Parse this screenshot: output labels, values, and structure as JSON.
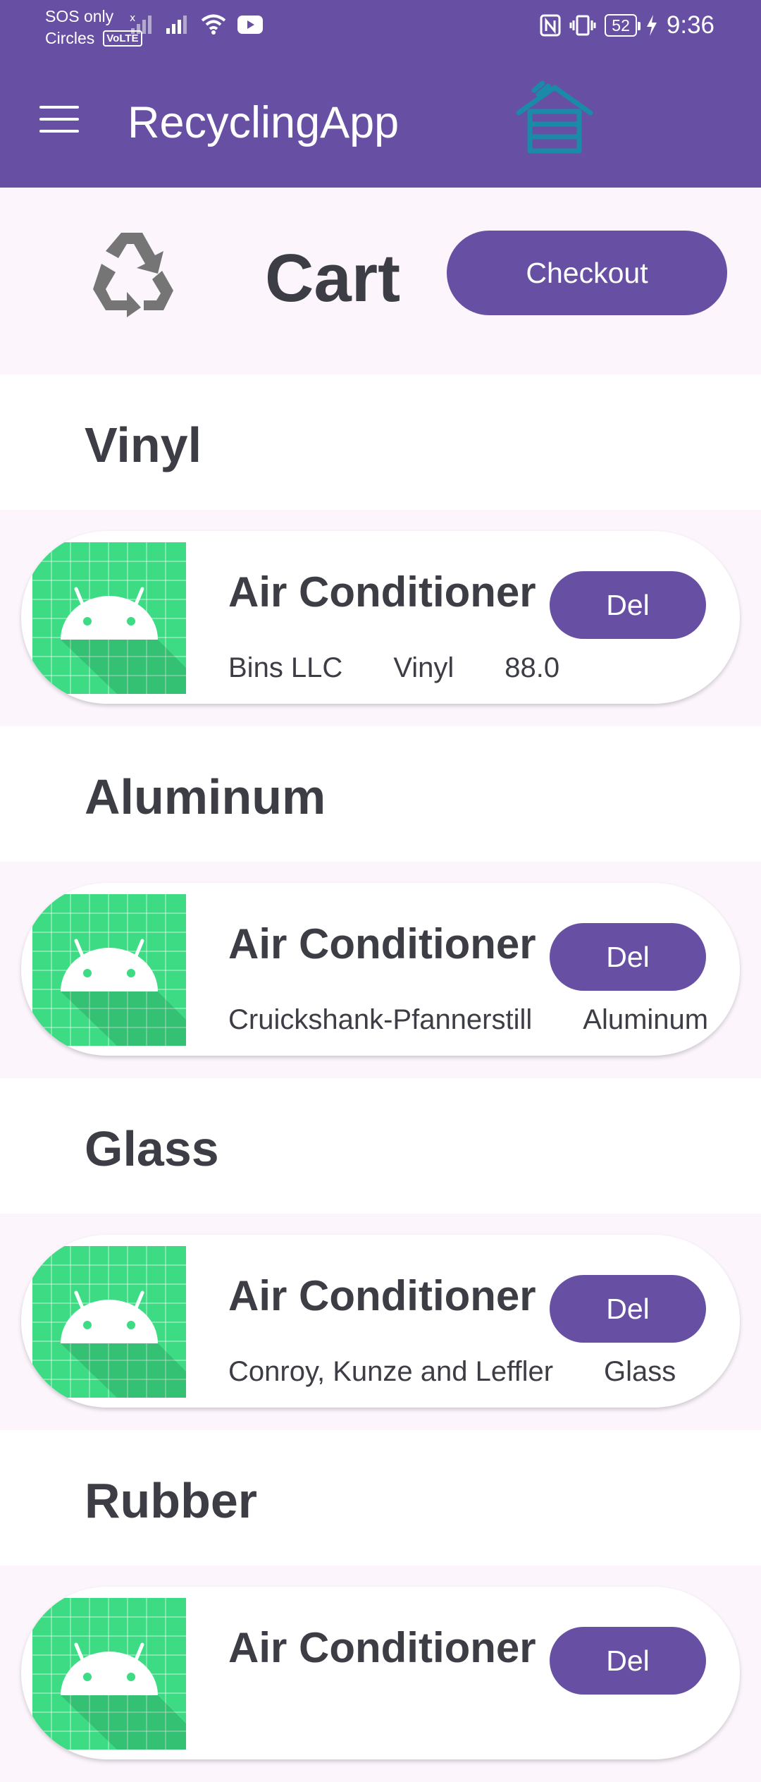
{
  "status_bar": {
    "carrier_line1": "SOS only",
    "carrier_line2": "Circles",
    "volte": "VoLTE",
    "battery": "52",
    "time": "9:36"
  },
  "app_bar": {
    "title": "RecyclingApp",
    "menu_icon": "hamburger-menu-icon",
    "logo_icon": "house-icon",
    "background": "#6750a4"
  },
  "cart": {
    "title": "Cart",
    "checkout_label": "Checkout",
    "logo_icon": "recycle-icon"
  },
  "sections": [
    {
      "category": "Vinyl",
      "items": [
        {
          "name": "Air Conditioner",
          "company": "Bins LLC",
          "material": "Vinyl",
          "price": "88.0",
          "delete_label": "Del"
        }
      ]
    },
    {
      "category": "Aluminum",
      "items": [
        {
          "name": "Air Conditioner",
          "company": "Cruickshank-Pfannerstill",
          "material": "Aluminum",
          "price": "",
          "delete_label": "Del"
        }
      ]
    },
    {
      "category": "Glass",
      "items": [
        {
          "name": "Air Conditioner",
          "company": "Conroy, Kunze and Leffler",
          "material": "Glass",
          "price": "",
          "delete_label": "Del"
        }
      ]
    },
    {
      "category": "Rubber",
      "items": [
        {
          "name": "Air Conditioner",
          "company": "",
          "material": "",
          "price": "",
          "delete_label": "Del"
        }
      ]
    }
  ],
  "colors": {
    "accent": "#6750a4",
    "surface": "#fcf5fc",
    "card": "#ffffff",
    "thumbnail": "#3ddc84",
    "text": "#3d3d45"
  }
}
